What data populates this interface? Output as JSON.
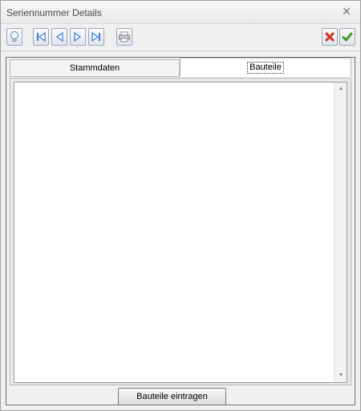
{
  "window": {
    "title": "Seriennummer Details",
    "close_symbol": "✕"
  },
  "toolbar": {
    "buttons": [
      {
        "icon": "lightbulb-icon"
      },
      {
        "icon": "first-record-icon"
      },
      {
        "icon": "previous-record-icon"
      },
      {
        "icon": "next-record-icon"
      },
      {
        "icon": "last-record-icon"
      },
      {
        "icon": "print-icon"
      },
      {
        "icon": "cancel-icon"
      },
      {
        "icon": "confirm-icon"
      }
    ]
  },
  "tabs": [
    {
      "label": "Stammdaten",
      "selected": false
    },
    {
      "label": "Bauteile",
      "selected": true
    }
  ],
  "bauteile": {
    "items": [],
    "add_button_label": "Bauteile eintragen"
  },
  "colors": {
    "nav_blue": "#3a78d6",
    "cancel_red": "#d43a2f",
    "confirm_green": "#3e9c2b"
  }
}
